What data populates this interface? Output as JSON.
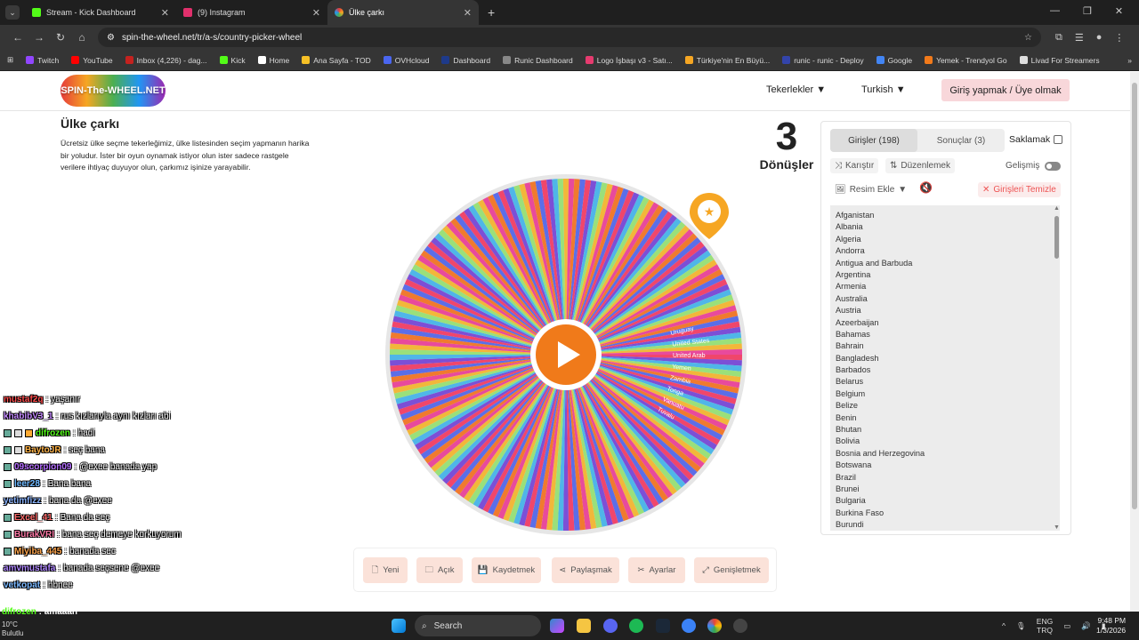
{
  "browser": {
    "tabs": [
      {
        "title": "Stream - Kick Dashboard",
        "color": "#53fc18"
      },
      {
        "title": "(9) Instagram",
        "color": "#e1306c"
      },
      {
        "title": "Ülke çarkı",
        "color": "#f6a623"
      }
    ],
    "url": "spin-the-wheel.net/tr/a-s/country-picker-wheel",
    "bookmarks": [
      "Twitch",
      "YouTube",
      "Inbox (4,226) - dag...",
      "Kick",
      "Home",
      "Ana Sayfa - TOD",
      "OVHcloud",
      "Dashboard",
      "Runic Dashboard",
      "Logo İşbaşı v3 - Satı...",
      "Türkiye'nin En Büyü...",
      "runic - runic - Deploy",
      "Google",
      "Yemek - Trendyol Go",
      "Livad For Streamers"
    ],
    "bookmark_colors": [
      "#9146ff",
      "#ff0000",
      "#c5221f",
      "#53fc18",
      "#ffffff",
      "#f6c026",
      "#4a66f0",
      "#1e3a8a",
      "#888888",
      "#e63b6f",
      "#f5a623",
      "#3344aa",
      "#4285f4",
      "#f27a1a",
      "#dddddd"
    ]
  },
  "site": {
    "logo": "SPIN-The-WHEEL.NET",
    "nav_wheels": "Tekerlekler ▼",
    "nav_lang": "Turkish ▼",
    "login": "Giriş yapmak / Üye olmak",
    "title": "Ülke çarkı",
    "description": "Ücretsiz ülke seçme tekerleğimiz, ülke listesinden seçim yapmanın harika bir yoludur. İster bir oyun oynamak istiyor olun ister sadece rastgele verilere ihtiyaç duyuyor olun, çarkımız işinize yarayabilir.",
    "spin_count": "3",
    "spin_label": "Dönüşler"
  },
  "panel": {
    "tab_entries": "Girişler (198)",
    "tab_results": "Sonuçlar (3)",
    "hide": "Saklamak",
    "shuffle": "Karıştır",
    "sort": "Düzenlemek",
    "advanced": "Gelişmiş",
    "add_image": "Resim Ekle",
    "clear": "Girişleri Temizle",
    "entries": [
      "Afganistan",
      "Albania",
      "Algeria",
      "Andorra",
      "Antigua and Barbuda",
      "Argentina",
      "Armenia",
      "Australia",
      "Austria",
      "Azeerbaijan",
      "Bahamas",
      "Bahrain",
      "Bangladesh",
      "Barbados",
      "Belarus",
      "Belgium",
      "Belize",
      "Benin",
      "Bhutan",
      "Bolivia",
      "Bosnia and Herzegovina",
      "Botswana",
      "Brazil",
      "Brunei",
      "Bulgaria",
      "Burkina Faso",
      "Burundi"
    ]
  },
  "bottom": {
    "new": "Yeni",
    "open": "Açık",
    "save": "Kaydetmek",
    "share": "Paylaşmak",
    "settings": "Ayarlar",
    "expand": "Genişletmek"
  },
  "wheel": {
    "palette": [
      "#f0466b",
      "#7c4fd6",
      "#4fb6e8",
      "#9ae07a",
      "#f2b73a",
      "#e84a9c",
      "#f07a2e",
      "#5b6ee8"
    ],
    "segment_count": 198,
    "labels": [
      "Uruguay",
      "United States",
      "United Arab",
      "Yemen",
      "Zambia",
      "Tonga",
      "Vanuatu",
      "Tuvalu"
    ]
  },
  "chat": [
    {
      "user": "mustaf2q",
      "msg": "yaşanır",
      "color": "#ff4d4d",
      "badges": 0
    },
    {
      "user": "khabibV3_1",
      "msg": "rus kızlarıyla aynı kızları abi",
      "color": "#c48aff",
      "badges": 0
    },
    {
      "user": "difrozen",
      "msg": "hadi",
      "color": "#53fc18",
      "badges": 3
    },
    {
      "user": "BaytoJR",
      "msg": "seç bana",
      "color": "#ffb347",
      "badges": 2
    },
    {
      "user": "09scorpion09",
      "msg": "@exee banada yap",
      "color": "#b46cff",
      "badges": 1
    },
    {
      "user": "leer28",
      "msg": "Bana bana",
      "color": "#6cb8ff",
      "badges": 1
    },
    {
      "user": "yetimfizz",
      "msg": "bana da @exee",
      "color": "#8ab4ff",
      "badges": 0
    },
    {
      "user": "Excel_41",
      "msg": "Bana da seç",
      "color": "#ff6b6b",
      "badges": 1
    },
    {
      "user": "BurakVRI",
      "msg": "bana seç demeye korkuyorum",
      "color": "#ff7aa8",
      "badges": 1
    },
    {
      "user": "Miyiba_445",
      "msg": "banada sec",
      "color": "#ffa64d",
      "badges": 1
    },
    {
      "user": "amvmustafa",
      "msg": "banada seçsene @exee",
      "color": "#b088ff",
      "badges": 0
    },
    {
      "user": "vetkopat",
      "msg": "hbnee",
      "color": "#7ab8ff",
      "badges": 0
    }
  ],
  "chat_last": {
    "user": "difrozen",
    "msg": "amaaan"
  },
  "taskbar": {
    "search": "Search",
    "lang1": "ENG",
    "lang2": "TRQ",
    "time": "9:48 PM",
    "date": "1/3/2026",
    "weather_temp": "10°C",
    "weather_text": "Bulutlu"
  }
}
